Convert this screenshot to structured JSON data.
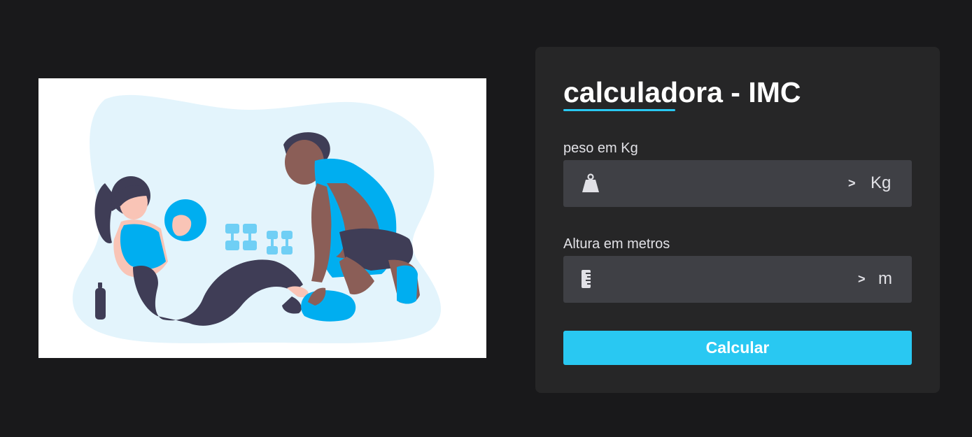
{
  "illustration": {
    "icon": "fitness-workout-illustration",
    "colors": {
      "accent": "#00aef0",
      "light_accent": "#6fcff5",
      "bg_blob": "#e3f4fc",
      "skin_dark": "#8b5e57",
      "skin_light": "#f9c4b6",
      "clothing_dark": "#3f3d56"
    }
  },
  "card": {
    "title": "calculadora - IMC",
    "weight": {
      "label": "peso em Kg",
      "icon": "weight-icon",
      "value": "",
      "arrow": ">",
      "unit": "Kg"
    },
    "height": {
      "label": "Altura em metros",
      "icon": "ruler-icon",
      "value": "",
      "arrow": ">",
      "unit": "m"
    },
    "button_label": "Calcular"
  },
  "colors": {
    "page_bg": "#19191b",
    "card_bg": "#262627",
    "input_bg": "#3f4045",
    "accent": "#29c8f2",
    "text": "#e1e1e6"
  }
}
